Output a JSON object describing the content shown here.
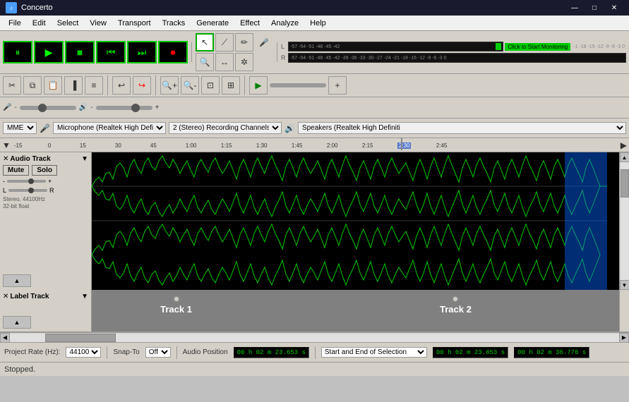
{
  "titleBar": {
    "icon": "♪",
    "title": "Concerto",
    "minBtn": "—",
    "maxBtn": "□",
    "closeBtn": "✕"
  },
  "menuBar": {
    "items": [
      "File",
      "Edit",
      "Select",
      "View",
      "Transport",
      "Tracks",
      "Generate",
      "Effect",
      "Analyze",
      "Help"
    ]
  },
  "transport": {
    "pauseBtn": "⏸",
    "playBtn": "▶",
    "stopBtn": "■",
    "prevBtn": "⏮",
    "nextBtn": "⏭",
    "recordBtn": "⏺"
  },
  "tools": {
    "selectTool": "↖",
    "envelopeTool": "✂",
    "drawTool": "✏",
    "micIcon": "🎤",
    "zoomInTool": "🔍",
    "timeTool": "↔",
    "multiTool": "*"
  },
  "vuMeter": {
    "lLabel": "L",
    "rLabel": "R",
    "monitorBtn": "Click to Start Monitoring",
    "scaleValues": "-57 -54 -51 -48 -45 -42",
    "scaleValues2": "-57 -54 -51 -48 -45 -42 -39 -36 -33 -30 -27 -24 -21 -18 -15 -12 -9 -6 -3 0"
  },
  "devices": {
    "audioSystem": "MME",
    "microphone": "Microphone (Realtek High Defini",
    "channels": "2 (Stereo) Recording Channels",
    "speaker": "Speakers (Realtek High Definiti"
  },
  "ruler": {
    "marks": [
      "-15",
      "0",
      "15",
      "30",
      "45",
      "1:00",
      "1:15",
      "1:30",
      "1:45",
      "2:00",
      "2:15",
      "2:30",
      "2:45"
    ]
  },
  "audioTrack": {
    "name": "Audio Track",
    "muteLabel": "Mute",
    "soloLabel": "Solo",
    "gainMin": "-",
    "gainMax": "+",
    "panMin": "L",
    "panMax": "R",
    "info": "Stereo, 44100Hz\n32-bit float",
    "expandIcon": "▲"
  },
  "labelTrack": {
    "name": "Label Track",
    "expandIcon": "▲",
    "label1": "Track 1",
    "label2": "Track 2",
    "label1Pos": "13%",
    "label2Pos": "66%"
  },
  "statusBar": {
    "projectRateLabel": "Project Rate (Hz):",
    "projectRate": "44100",
    "snapToLabel": "Snap-To",
    "snapToValue": "Off",
    "audioPositionLabel": "Audio Position",
    "selectionMode": "Start and End of Selection",
    "position1": "00 h 02 m 23.653 s",
    "position2": "00 h 02 m 23.653 s",
    "position3": "00 h 02 m 36.776 s"
  },
  "stoppedBar": {
    "text": "Stopped."
  }
}
